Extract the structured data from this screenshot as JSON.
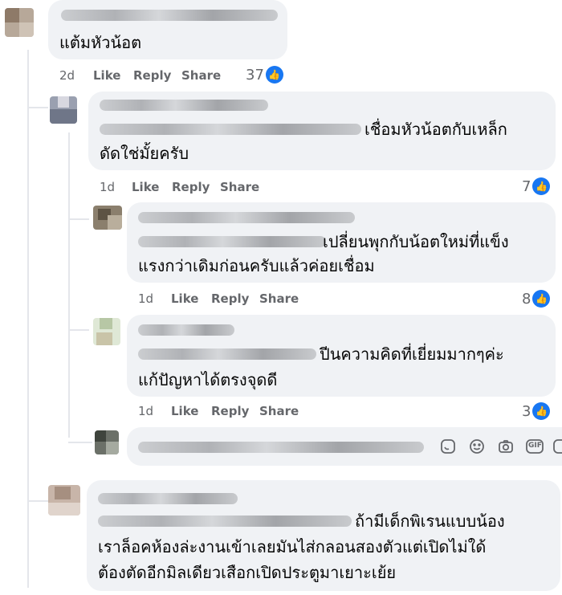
{
  "comments": [
    {
      "id": "c1",
      "text_lines": [
        "แต้มหัวน้อต"
      ],
      "time": "2d",
      "like": "Like",
      "reply": "Reply",
      "share": "Share",
      "reactions": "37"
    },
    {
      "id": "c2",
      "text_lines": [
        "เชื่อมหัวน้อตกับเหล็ก",
        "ดัดใช่มั้ยครับ"
      ],
      "time": "1d",
      "like": "Like",
      "reply": "Reply",
      "share": "Share",
      "reactions": "7"
    },
    {
      "id": "c3",
      "text_lines": [
        "เปลี่ยนพุกกับน้อตใหม่ที่แข็ง",
        "แรงกว่าเดิมก่อนครับแล้วค่อยเชื่อม"
      ],
      "time": "1d",
      "like": "Like",
      "reply": "Reply",
      "share": "Share",
      "reactions": "8"
    },
    {
      "id": "c4",
      "text_lines": [
        "ปีนความคิดที่เยี่ยมมากๆค่ะ",
        "แก้ปัญหาได้ตรงจุดดี"
      ],
      "time": "1d",
      "like": "Like",
      "reply": "Reply",
      "share": "Share",
      "reactions": "3"
    },
    {
      "id": "c5",
      "text_lines": [
        "ถ้ามีเด็กพิเรนแบบน้อง",
        "เราล็อคห้องล่ะงานเข้าเลยมันไส่กลอนสองตัวแต่เปิดไม่ใด้",
        "ต้องตัดอีกมิลเดียวเสือกเปิดประตูมาเยาะเย้ย"
      ]
    }
  ],
  "reply_box": {
    "icons": [
      "sticker-icon",
      "emoji-icon",
      "camera-icon",
      "gif-icon",
      "more-sticker-icon"
    ],
    "gif_label": "GIF"
  },
  "colors": {
    "bubble": "#f0f2f5",
    "like_blue": "#1877f2",
    "meta": "#65676b"
  }
}
